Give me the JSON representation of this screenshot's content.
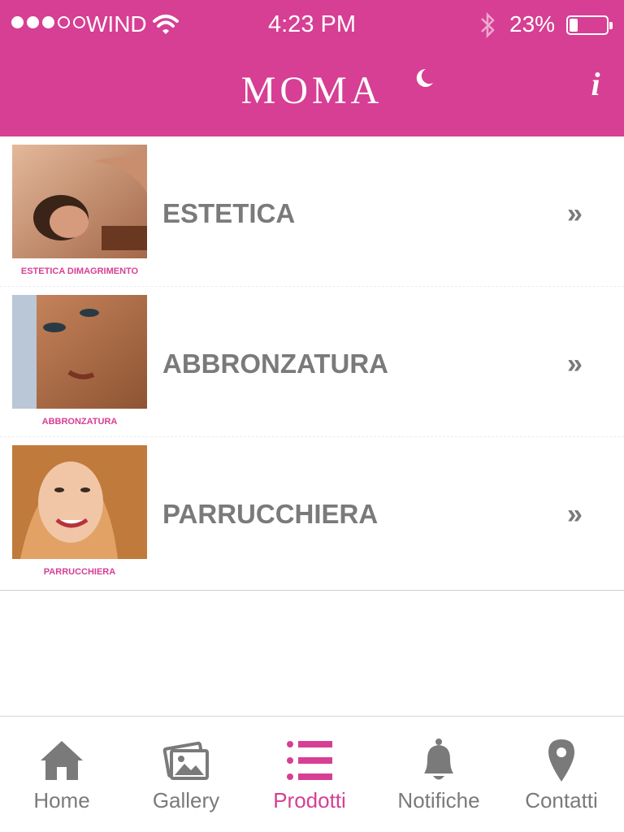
{
  "status_bar": {
    "carrier": "WIND",
    "time": "4:23 PM",
    "battery_percent": "23%",
    "signal_bars_filled": 3,
    "signal_bars_total": 5,
    "battery_level": 0.23
  },
  "header": {
    "logo_text": "MOMA",
    "info_button": "i",
    "background_color": "#d63f93"
  },
  "list": {
    "items": [
      {
        "label": "ESTETICA",
        "thumb_caption": "ESTETICA DIMAGRIMENTO",
        "chevron": "»",
        "thumb_icon": "massage-photo-icon"
      },
      {
        "label": "ABBRONZATURA",
        "thumb_caption": "ABBRONZATURA",
        "chevron": "»",
        "thumb_icon": "tanned-face-photo-icon"
      },
      {
        "label": "PARRUCCHIERA",
        "thumb_caption": "PARRUCCHIERA",
        "chevron": "»",
        "thumb_icon": "hair-woman-photo-icon"
      }
    ]
  },
  "tabbar": {
    "active_color": "#d63f93",
    "inactive_color": "#7a7a7a",
    "tabs": [
      {
        "label": "Home",
        "icon": "home-icon",
        "active": false
      },
      {
        "label": "Gallery",
        "icon": "gallery-icon",
        "active": false
      },
      {
        "label": "Prodotti",
        "icon": "list-icon",
        "active": true
      },
      {
        "label": "Notifiche",
        "icon": "bell-icon",
        "active": false
      },
      {
        "label": "Contatti",
        "icon": "map-pin-icon",
        "active": false
      }
    ]
  }
}
